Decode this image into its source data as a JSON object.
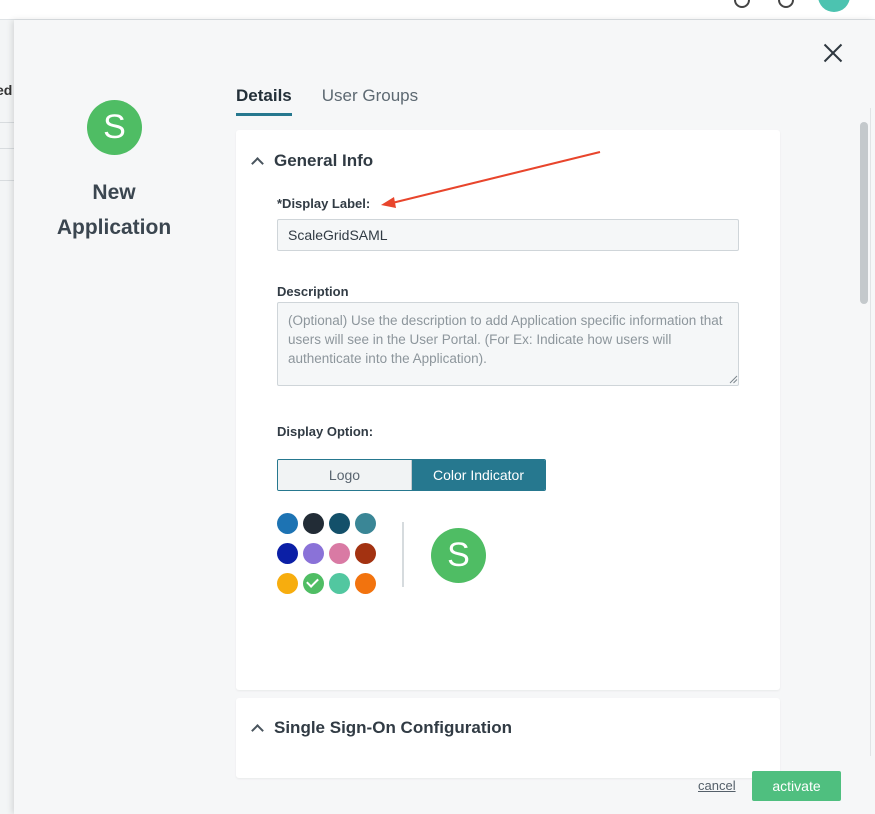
{
  "background": {
    "left_fragment_text": "ed"
  },
  "modal": {
    "close_icon": "close-icon",
    "sidebar": {
      "avatar_letter": "S",
      "title": "New Application"
    },
    "tabs": [
      {
        "label": "Details",
        "active": true
      },
      {
        "label": "User Groups",
        "active": false
      }
    ],
    "general_info": {
      "section_title": "General Info",
      "display_label": {
        "label": "*Display Label:",
        "value": "ScaleGridSAML"
      },
      "description": {
        "label": "Description",
        "placeholder": "(Optional) Use the description to add Application specific information that users will see in the User Portal. (For Ex: Indicate how users will authenticate into the Application).",
        "value": ""
      },
      "display_option": {
        "label": "Display Option:",
        "options": [
          "Logo",
          "Color Indicator"
        ],
        "selected": "Color Indicator"
      },
      "colors": [
        "#1d73b3",
        "#222c36",
        "#13506a",
        "#3a8696",
        "#0b1fa6",
        "#8a72d8",
        "#d97aa4",
        "#a33211",
        "#f7ad0e",
        "#4fbd64",
        "#52c7a0",
        "#f2730e"
      ],
      "selected_color": "#4fbd64",
      "preview_letter": "S"
    },
    "sso": {
      "section_title": "Single Sign-On Configuration"
    },
    "footer": {
      "cancel_label": "cancel",
      "activate_label": "activate"
    },
    "annotation_color": "#e8452c"
  }
}
